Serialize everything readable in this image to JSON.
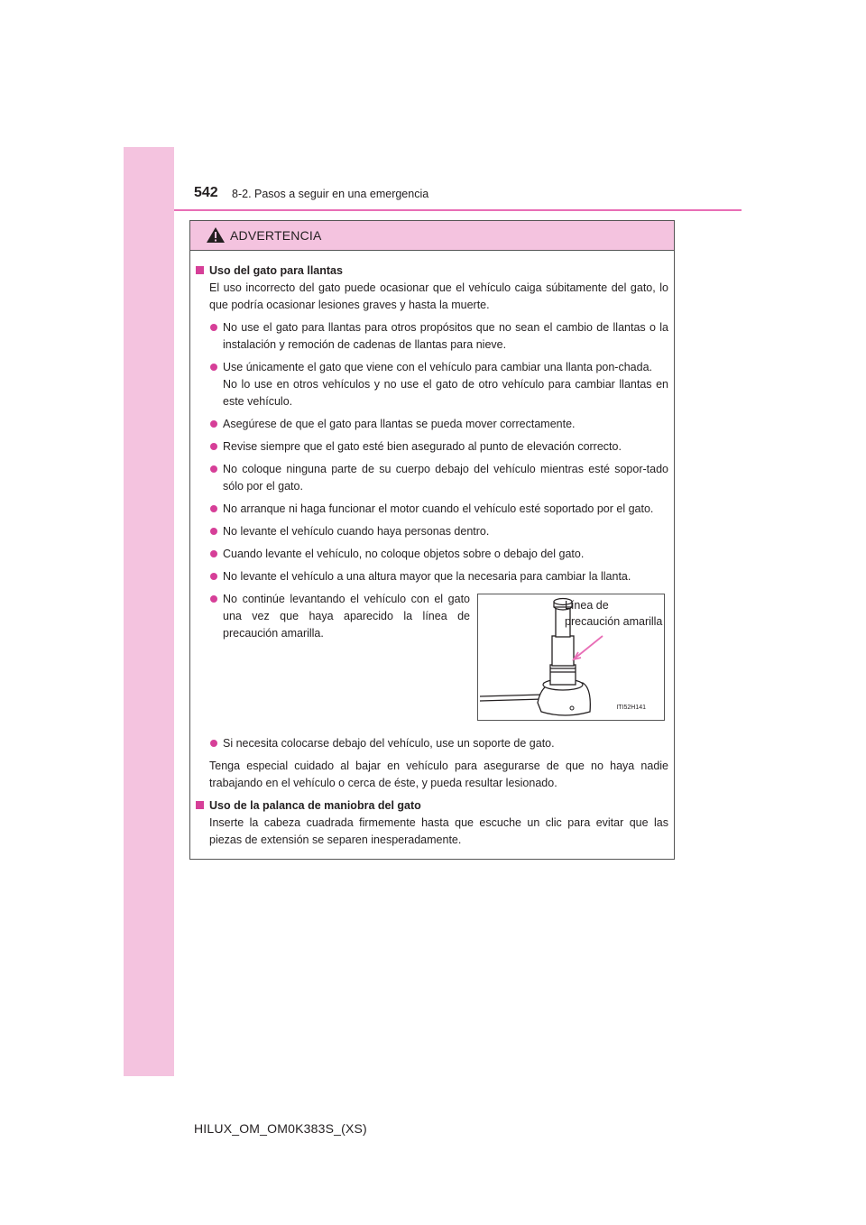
{
  "header": {
    "page_number": "542",
    "section": "8-2. Pasos a seguir en una emergencia"
  },
  "warning": {
    "title": "ADVERTENCIA",
    "section1": {
      "heading": "Uso del gato para llantas",
      "intro": "El uso incorrecto del gato puede ocasionar que el vehículo caiga súbitamente del gato, lo que podría ocasionar lesiones graves y hasta la muerte.",
      "bullets": [
        "No use el gato para llantas para otros propósitos que no sean el cambio de llantas o la instalación y remoción de cadenas de llantas para nieve.",
        "Use únicamente el gato que viene con el vehículo para cambiar una llanta pon-chada.",
        "No lo use en otros vehículos y no use el gato de otro vehículo para cambiar llantas en este vehículo.",
        "Asegúrese de que el gato para llantas se pueda mover correctamente.",
        "Revise siempre que el gato esté bien asegurado al punto de elevación correcto.",
        "No coloque ninguna parte de su cuerpo debajo del vehículo mientras esté sopor-tado sólo por el gato.",
        "No arranque ni haga funcionar el motor cuando el vehículo esté soportado por el gato.",
        "No levante el vehículo cuando haya personas dentro.",
        "Cuando levante el vehículo, no coloque objetos sobre o debajo del gato.",
        "No levante el vehículo a una altura mayor que la necesaria para cambiar la llanta.",
        "No continúe levantando el vehículo con el gato una vez que haya aparecido la línea de precaución amarilla.",
        "Si necesita colocarse debajo del vehículo, use un soporte de gato."
      ],
      "closing": "Tenga especial cuidado al bajar en vehículo para asegurarse de que no haya nadie trabajando en el vehículo o cerca de éste, y pueda resultar lesionado."
    },
    "figure": {
      "label": "Línea de precaución amarilla",
      "code": "ITI52H141"
    },
    "section2": {
      "heading": "Uso de la palanca de maniobra del gato",
      "text": "Inserte la cabeza cuadrada firmemente hasta que escuche un clic para evitar que las piezas de extensión se separen inesperadamente."
    }
  },
  "footer": {
    "model_code": "HILUX_OM_OM0K383S_(XS)"
  },
  "colors": {
    "accent_pink": "#f4c3df",
    "bullet_magenta": "#d63f98",
    "rule_pink": "#e86eb6"
  }
}
